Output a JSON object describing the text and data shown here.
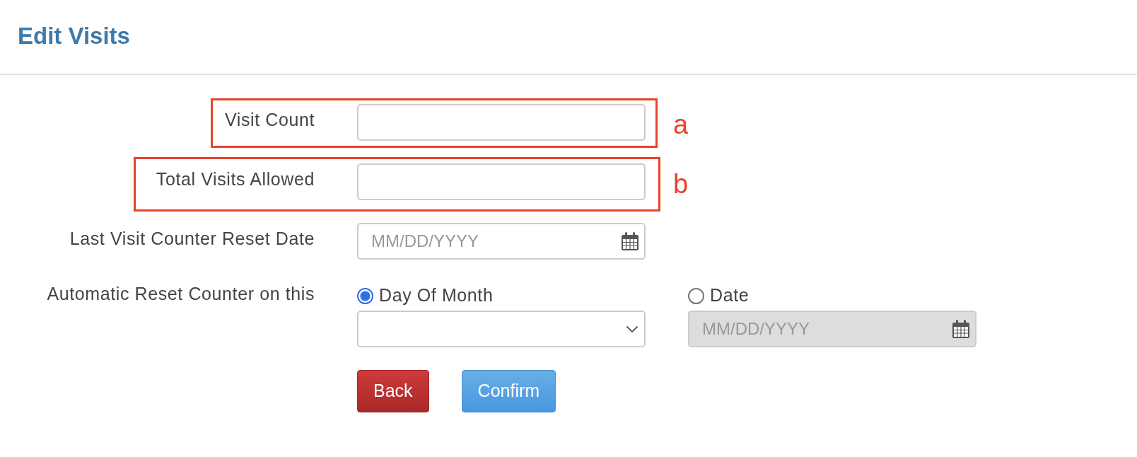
{
  "title": "Edit Visits",
  "fields": [
    {
      "kind": "text",
      "label": "Visit Count",
      "annotation": "a"
    },
    {
      "kind": "text",
      "label": "Total Visits Allowed",
      "annotation": "b"
    },
    {
      "kind": "date",
      "label": "Last Visit Counter Reset Date",
      "placeholder": "MM/DD/YYYY"
    },
    {
      "kind": "reset",
      "label": "Automatic Reset Counter on this",
      "options": [
        {
          "label": "Day Of Month",
          "selected": true,
          "kind": "select"
        },
        {
          "label": "Date",
          "selected": false,
          "kind": "date",
          "placeholder": "MM/DD/YYYY",
          "disabled": true
        }
      ]
    }
  ],
  "buttons": [
    {
      "label": "Back",
      "kind": "danger"
    },
    {
      "label": "Confirm",
      "kind": "primary"
    }
  ]
}
